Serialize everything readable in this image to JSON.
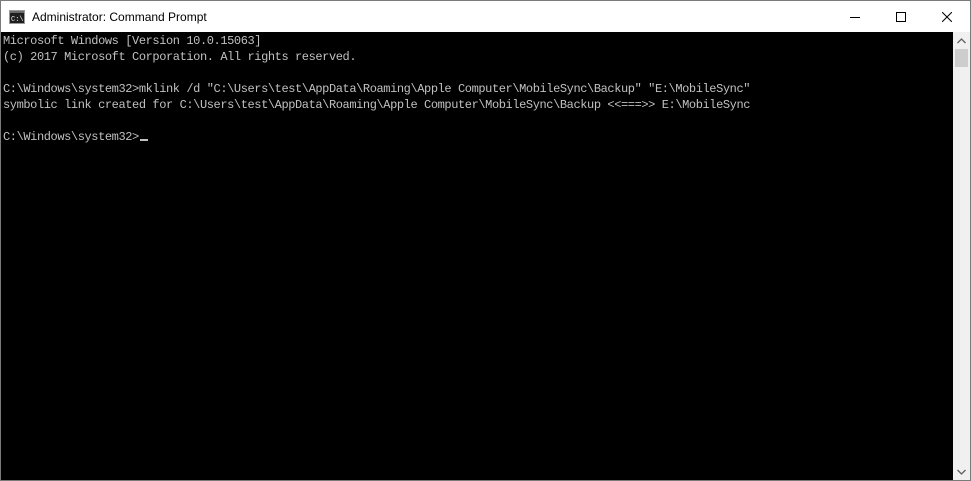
{
  "window": {
    "title": "Administrator: Command Prompt"
  },
  "titlebar": {
    "icon": "cmd-icon",
    "buttons": [
      "minimize-icon",
      "maximize-icon",
      "close-icon"
    ]
  },
  "console": {
    "lines": [
      "Microsoft Windows [Version 10.0.15063]",
      "(c) 2017 Microsoft Corporation. All rights reserved.",
      "",
      "C:\\Windows\\system32>mklink /d \"C:\\Users\\test\\AppData\\Roaming\\Apple Computer\\MobileSync\\Backup\" \"E:\\MobileSync\"",
      "symbolic link created for C:\\Users\\test\\AppData\\Roaming\\Apple Computer\\MobileSync\\Backup <<===>> E:\\MobileSync",
      "",
      "C:\\Windows\\system32>"
    ]
  },
  "colors": {
    "console_background": "#000000",
    "console_text": "#c0c0c0",
    "titlebar_background": "#ffffff",
    "scrollbar_track": "#f0f0f0",
    "scrollbar_thumb": "#cdcdcd"
  }
}
